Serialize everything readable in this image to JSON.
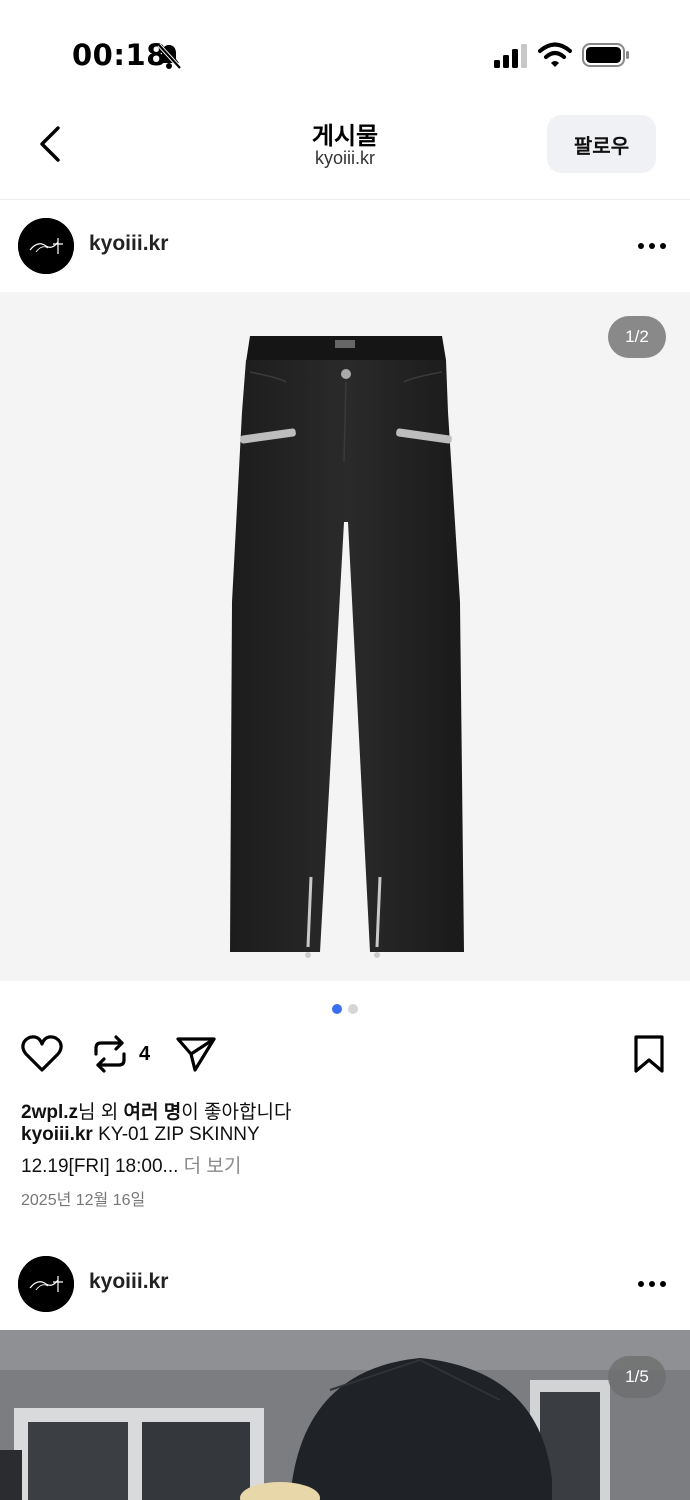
{
  "status_bar": {
    "time": "00:18"
  },
  "header": {
    "title": "게시물",
    "subtitle": "kyoiii.kr",
    "follow_label": "팔로우"
  },
  "posts": [
    {
      "username": "kyoiii.kr",
      "counter": "1/2",
      "dots_total": 2,
      "dots_active": 1,
      "repost_count": "4",
      "likes_user": "2wpl.z",
      "likes_mid": "님 외 ",
      "likes_bold": "여러 명",
      "likes_end": "이 좋아합니다",
      "caption_user": "kyoiii.kr",
      "caption_text": " KY-01 ZIP SKINNY",
      "caption_line2": "12.19[FRI] 18:00...",
      "more_label": " 더 보기",
      "date": "2025년 12월 16일"
    },
    {
      "username": "kyoiii.kr",
      "counter": "1/5"
    }
  ],
  "colors": {
    "accent_dot": "#3a6ff0",
    "follow_bg": "#eff1f4",
    "media_bg": "#f4f4f4"
  },
  "icons": [
    "back-icon",
    "bell-muted-icon",
    "signal-icon",
    "wifi-icon",
    "battery-icon",
    "more-icon",
    "heart-icon",
    "repost-icon",
    "send-icon",
    "bookmark-icon"
  ]
}
